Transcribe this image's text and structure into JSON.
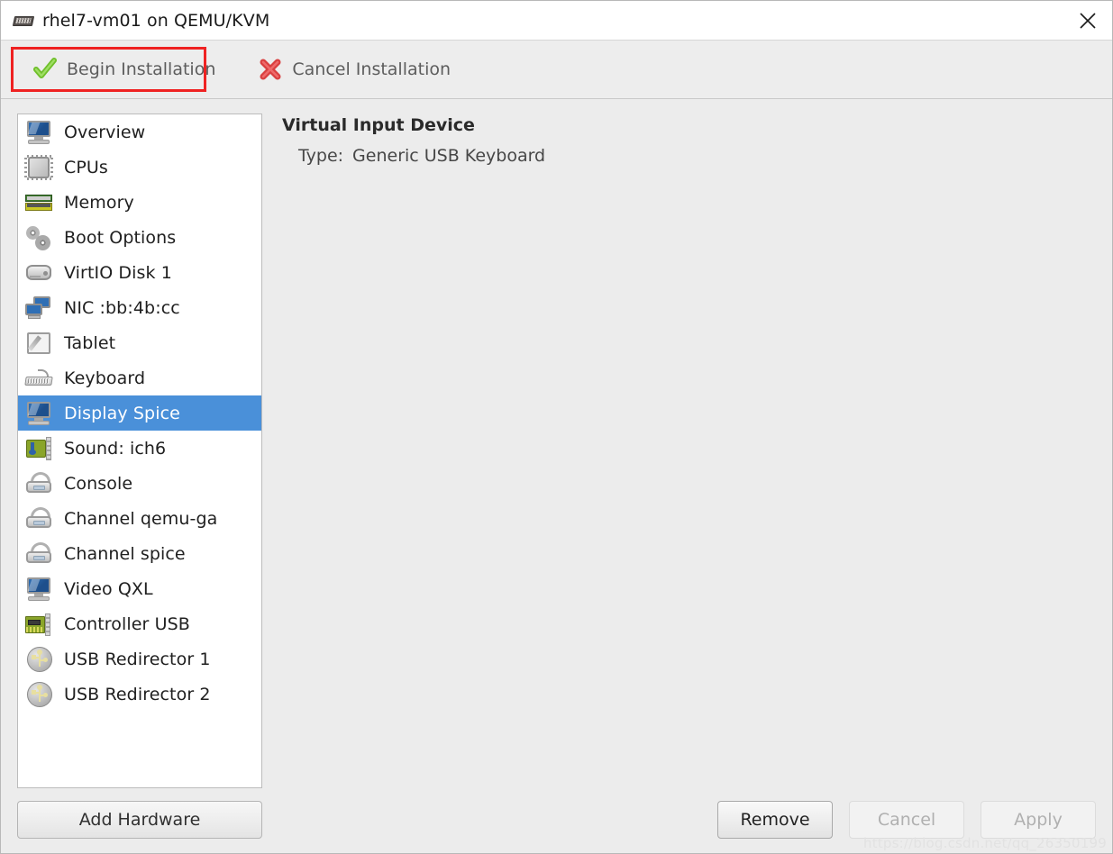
{
  "window": {
    "title": "rhel7-vm01 on QEMU/KVM",
    "title_icon": "keyboard-vm-icon",
    "close_icon": "close-icon"
  },
  "toolbar": {
    "begin_label": "Begin Installation",
    "begin_icon": "green-check-icon",
    "cancel_label": "Cancel Installation",
    "cancel_icon": "red-x-icon",
    "annotation_color": "#ef2222"
  },
  "sidebar": {
    "selected_index": 8,
    "items": [
      {
        "label": "Overview",
        "icon": "monitor-icon"
      },
      {
        "label": "CPUs",
        "icon": "cpu-chip-icon"
      },
      {
        "label": "Memory",
        "icon": "memory-module-icon"
      },
      {
        "label": "Boot Options",
        "icon": "gears-icon"
      },
      {
        "label": "VirtIO Disk 1",
        "icon": "hard-disk-icon"
      },
      {
        "label": "NIC :bb:4b:cc",
        "icon": "network-card-icon"
      },
      {
        "label": "Tablet",
        "icon": "tablet-pen-icon"
      },
      {
        "label": "Keyboard",
        "icon": "keyboard-icon"
      },
      {
        "label": "Display Spice",
        "icon": "monitor-icon"
      },
      {
        "label": "Sound: ich6",
        "icon": "sound-card-icon"
      },
      {
        "label": "Console",
        "icon": "console-icon"
      },
      {
        "label": "Channel qemu-ga",
        "icon": "console-icon"
      },
      {
        "label": "Channel spice",
        "icon": "console-icon"
      },
      {
        "label": "Video QXL",
        "icon": "monitor-icon"
      },
      {
        "label": "Controller USB",
        "icon": "usb-controller-icon"
      },
      {
        "label": "USB Redirector 1",
        "icon": "usb-redirector-icon"
      },
      {
        "label": "USB Redirector 2",
        "icon": "usb-redirector-icon"
      }
    ],
    "add_hardware_label": "Add Hardware",
    "selection_color": "#4a90d9"
  },
  "detail": {
    "title": "Virtual Input Device",
    "fields": [
      {
        "key": "Type:",
        "value": "Generic USB Keyboard"
      }
    ]
  },
  "actions": {
    "remove_label": "Remove",
    "cancel_label": "Cancel",
    "apply_label": "Apply"
  },
  "watermark": "https://blog.csdn.net/qq_26350199"
}
